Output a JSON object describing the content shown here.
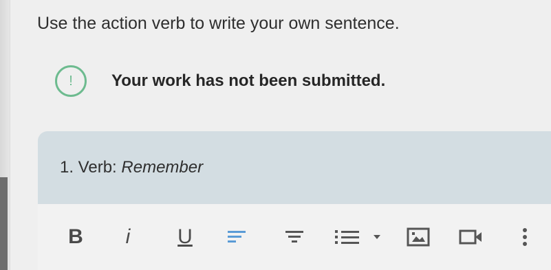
{
  "instructions": "Use the action verb to write your own sentence.",
  "status": {
    "icon": "exclamation-circle-icon",
    "icon_glyph": "!",
    "message": "Your work has not been submitted.",
    "accent_color": "#6dbb8f"
  },
  "question": {
    "prefix": "1. Verb: ",
    "term": "Remember"
  },
  "toolbar": {
    "bold": "B",
    "italic": "i",
    "underline": "U",
    "icons": [
      "bold-icon",
      "italic-icon",
      "underline-icon",
      "align-left-icon",
      "align-center-icon",
      "bulleted-list-icon",
      "list-dropdown-caret-icon",
      "insert-image-icon",
      "insert-video-icon",
      "more-options-icon"
    ],
    "highlight_color": "#5a9bd6"
  }
}
